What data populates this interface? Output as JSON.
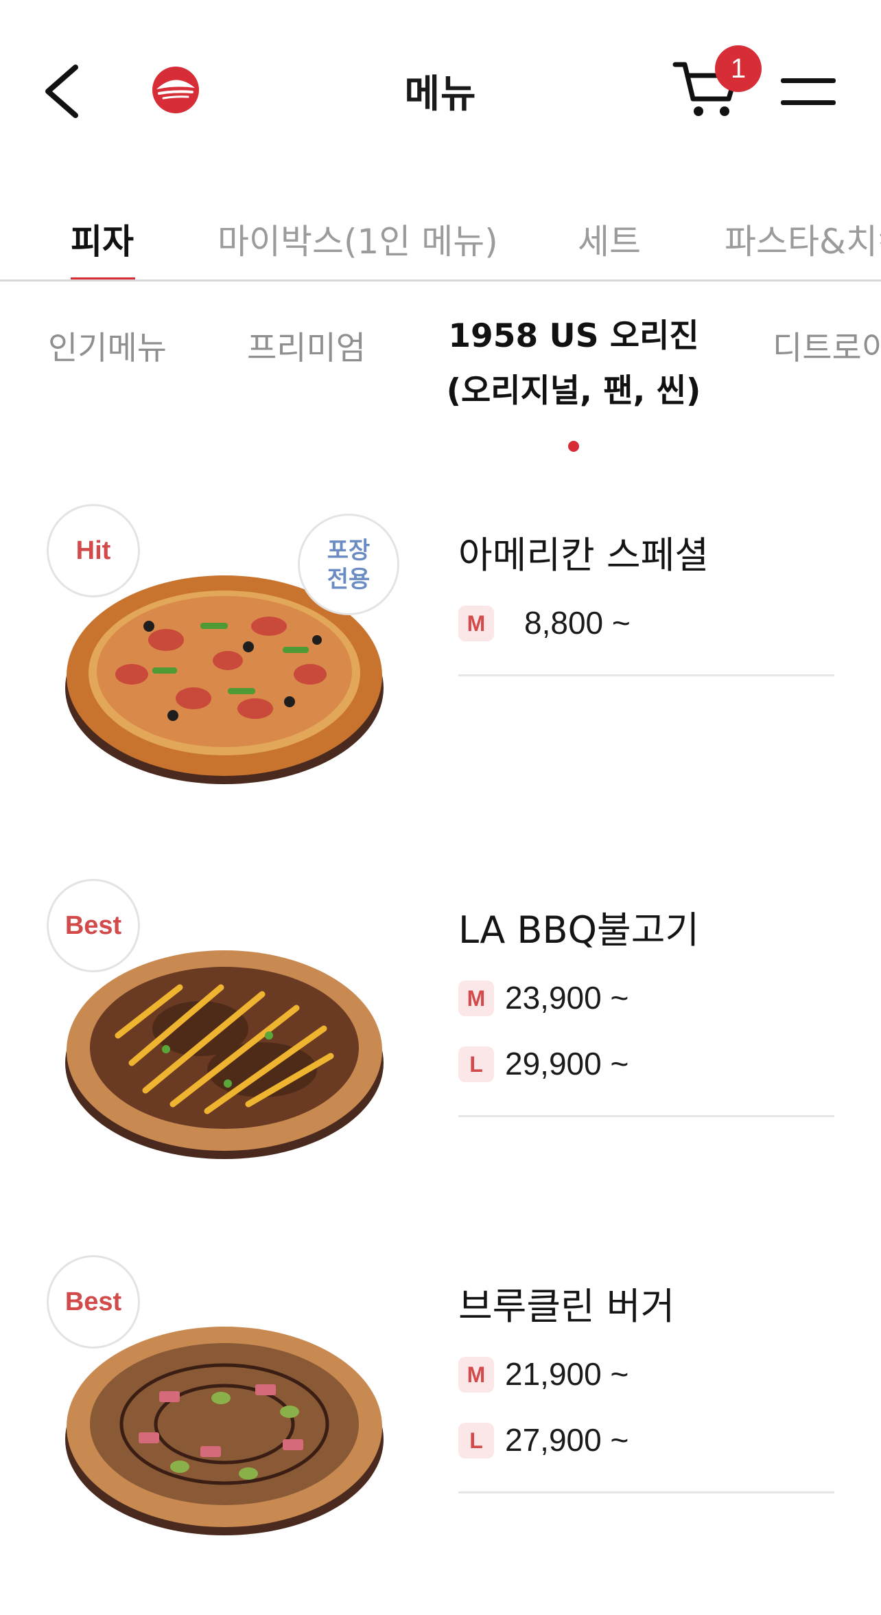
{
  "header": {
    "title": "메뉴",
    "cart_count": "1",
    "accent_color": "#d62d37"
  },
  "main_tabs": [
    {
      "label": "피자",
      "active": true
    },
    {
      "label": "마이박스(1인 메뉴)",
      "active": false
    },
    {
      "label": "세트",
      "active": false
    },
    {
      "label": "파스타&치킨",
      "active": false
    }
  ],
  "sub_tabs": [
    {
      "label": "인기메뉴",
      "active": false
    },
    {
      "label": "프리미엄",
      "active": false
    },
    {
      "label_line1": "1958 US 오리진",
      "label_line2": "(오리지널, 팬, 씬)",
      "active": true
    },
    {
      "label": "디트로이트",
      "active": false
    }
  ],
  "items": [
    {
      "name": "아메리칸 스페셜",
      "tag": "Hit",
      "extra_tag_line1": "포장",
      "extra_tag_line2": "전용",
      "prices": [
        {
          "size": "M",
          "price": "8,800 ~"
        }
      ]
    },
    {
      "name": "LA BBQ불고기",
      "tag": "Best",
      "prices": [
        {
          "size": "M",
          "price": "23,900 ~"
        },
        {
          "size": "L",
          "price": "29,900 ~"
        }
      ]
    },
    {
      "name": "브루클린 버거",
      "tag": "Best",
      "prices": [
        {
          "size": "M",
          "price": "21,900 ~"
        },
        {
          "size": "L",
          "price": "27,900 ~"
        }
      ]
    }
  ]
}
